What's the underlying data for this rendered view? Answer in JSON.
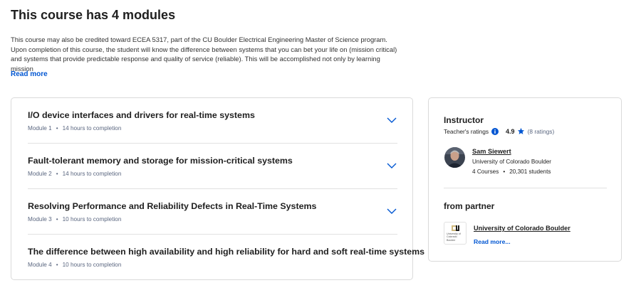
{
  "page": {
    "title": "This course has 4 modules",
    "description": "This course may also be credited toward ECEA 5317, part of the CU Boulder Electrical Engineering Master of Science program. Upon completion of this course, the student will know the difference between systems that you can bet your life on (mission critical) and systems that provide predictable response and quality of service (reliable). This will be accomplished not only by learning mission",
    "read_more": "Read more"
  },
  "modules": [
    {
      "title": "I/O device interfaces and drivers for real-time systems",
      "number": "Module 1",
      "duration": "14 hours to completion"
    },
    {
      "title": "Fault-tolerant memory and storage for mission-critical systems",
      "number": "Module 2",
      "duration": "14 hours to completion"
    },
    {
      "title": "Resolving Performance and Reliability Defects in Real-Time Systems",
      "number": "Module 3",
      "duration": "10 hours to completion"
    },
    {
      "title": "The difference between high availability and high reliability for hard and soft real-time systems",
      "number": "Module 4",
      "duration": "10 hours to completion"
    }
  ],
  "instructor": {
    "heading": "Instructor",
    "ratings_label": "Teacher's ratings",
    "rating": "4.9",
    "rating_count": "(8 ratings)",
    "name": "Sam Siewert",
    "organization": "University of Colorado Boulder",
    "courses": "4 Courses",
    "students": "20,301 students"
  },
  "partner": {
    "heading": "from partner",
    "name": "University of Colorado Boulder",
    "read_more": "Read more...",
    "logo_text": "University of Colorado Boulder"
  },
  "meta_separator": "•",
  "colors": {
    "accent": "#0056d2",
    "text": "#1f1f1f",
    "muted": "#5b6780",
    "border": "#dadada",
    "logo_gold": "#cfb87c"
  },
  "icons": {
    "expand": "chevron-down-icon",
    "info": "info-icon",
    "star": "star-icon"
  }
}
